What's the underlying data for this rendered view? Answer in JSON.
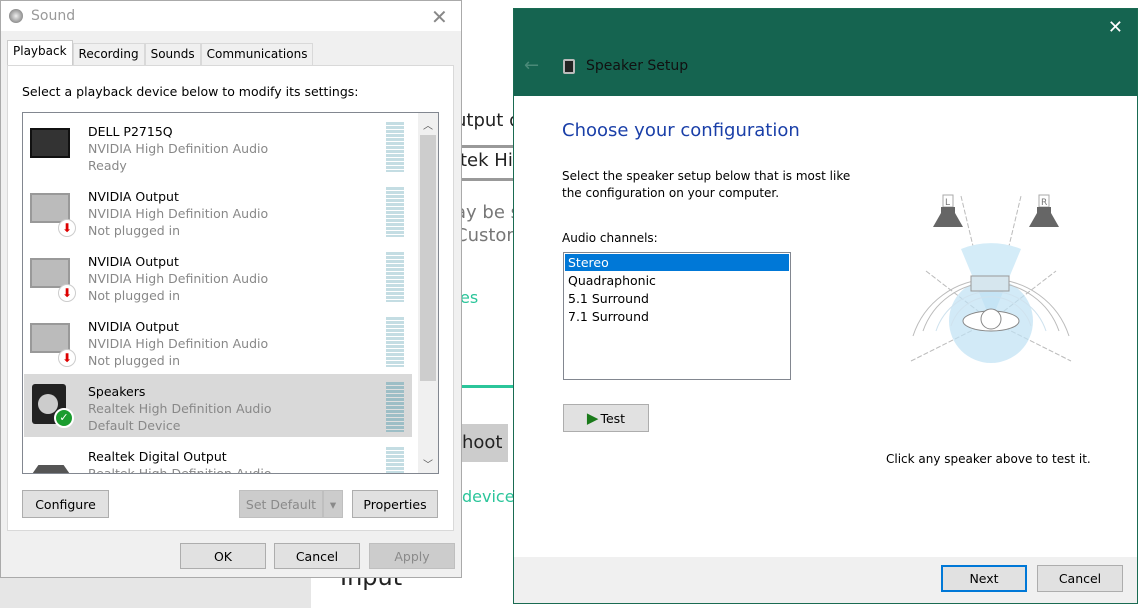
{
  "background_app": {
    "texts": [
      "utput de",
      "ltek Hi",
      "ay be se",
      "Custom",
      "es",
      "hoot",
      "devices",
      "Input"
    ]
  },
  "sound": {
    "title": "Sound",
    "tabs": [
      {
        "label": "Playback",
        "active": true
      },
      {
        "label": "Recording"
      },
      {
        "label": "Sounds"
      },
      {
        "label": "Communications"
      }
    ],
    "instruction": "Select a playback device below to modify its settings:",
    "devices": [
      {
        "name": "DELL P2715Q",
        "driver": "NVIDIA High Definition Audio",
        "status": "Ready",
        "icon": "monitor-icon"
      },
      {
        "name": "NVIDIA Output",
        "driver": "NVIDIA High Definition Audio",
        "status": "Not plugged in",
        "icon": "monitor-unplugged-icon"
      },
      {
        "name": "NVIDIA Output",
        "driver": "NVIDIA High Definition Audio",
        "status": "Not plugged in",
        "icon": "monitor-unplugged-icon"
      },
      {
        "name": "NVIDIA Output",
        "driver": "NVIDIA High Definition Audio",
        "status": "Not plugged in",
        "icon": "monitor-unplugged-icon"
      },
      {
        "name": "Speakers",
        "driver": "Realtek High Definition Audio",
        "status": "Default Device",
        "icon": "speaker-default-icon",
        "selected": true
      },
      {
        "name": "Realtek Digital Output",
        "driver": "Realtek High Definition Audio",
        "status": "",
        "icon": "digital-output-icon"
      }
    ],
    "buttons": {
      "configure": "Configure",
      "set_default": "Set Default",
      "properties": "Properties",
      "ok": "OK",
      "cancel": "Cancel",
      "apply": "Apply"
    }
  },
  "setup": {
    "title": "Speaker Setup",
    "heading": "Choose your configuration",
    "description_1": "Select the speaker setup below that is most like",
    "description_2": "the configuration on your computer.",
    "channels_label": "Audio channels:",
    "channels": [
      "Stereo",
      "Quadraphonic",
      "5.1 Surround",
      "7.1 Surround"
    ],
    "selected_channel": "Stereo",
    "test": "Test",
    "hint": "Click any speaker above to test it.",
    "speaker_labels": [
      "L",
      "R"
    ],
    "next": "Next",
    "cancel": "Cancel",
    "colors": {
      "header": "#156450",
      "heading": "#1a3fa8",
      "selection": "#0078d7"
    }
  }
}
